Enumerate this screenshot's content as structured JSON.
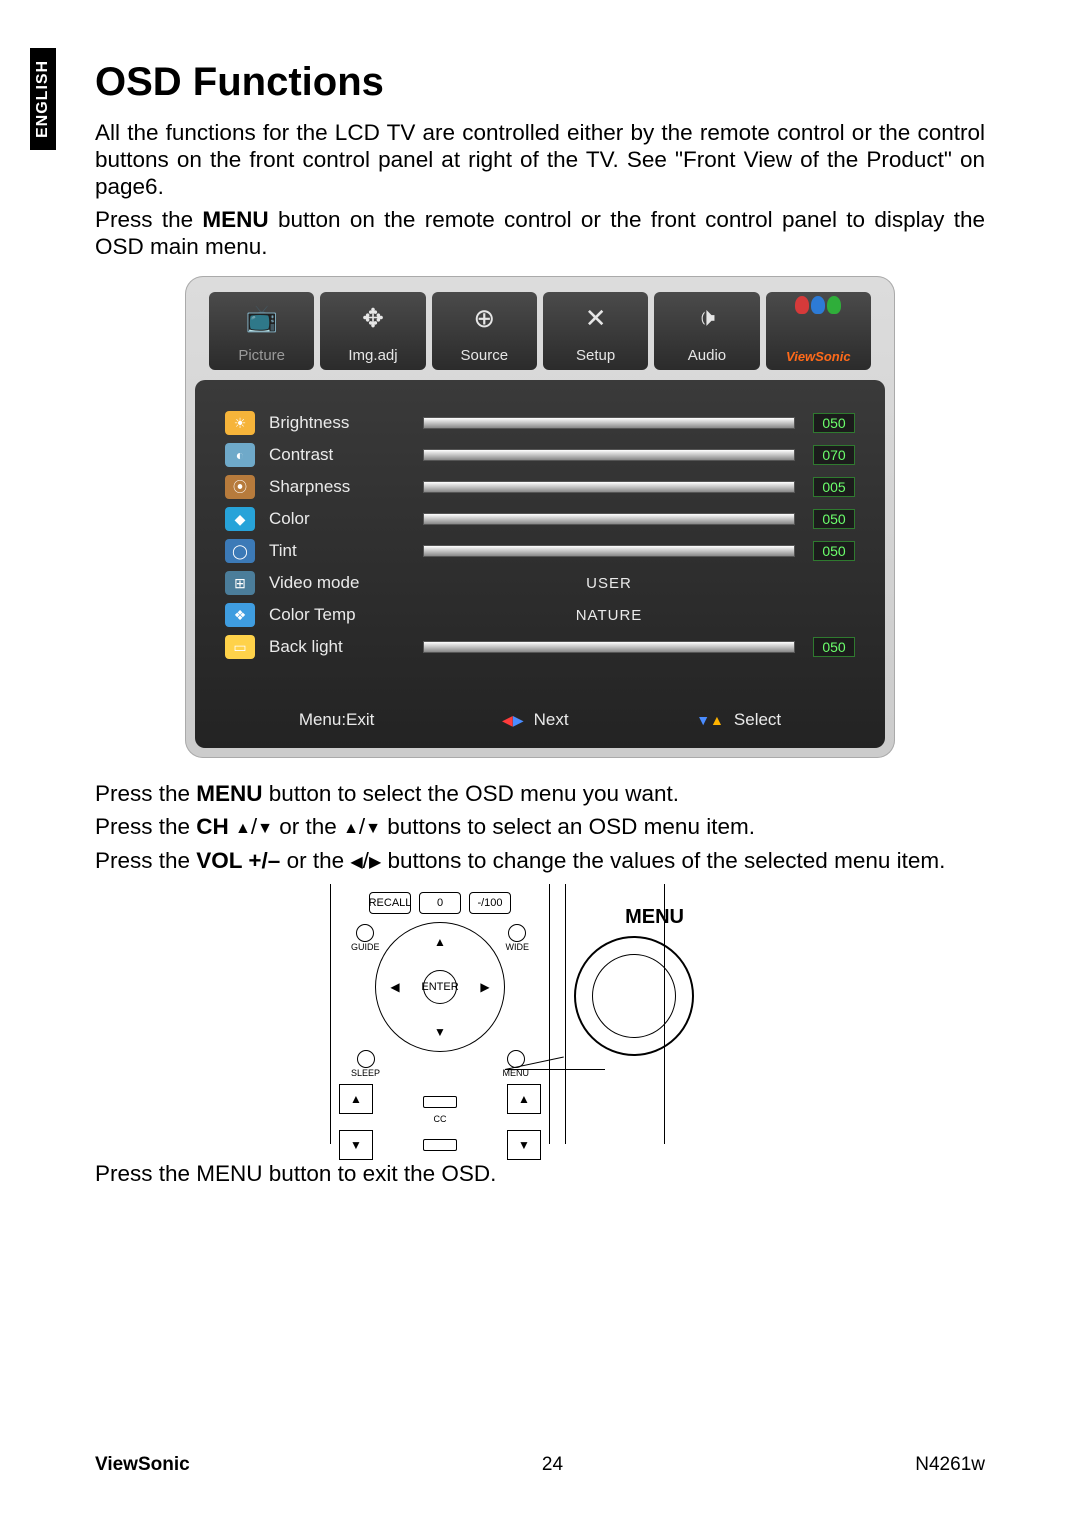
{
  "language_tab": "ENGLISH",
  "heading": "OSD Functions",
  "intro1": "All the functions for the LCD TV are controlled either by the remote control or the control buttons on the front control panel at right of the TV. See \"Front View of the Product\" on page6.",
  "intro2_a": "Press the ",
  "intro2_b": "MENU",
  "intro2_c": " button on the remote control or the front control panel to display the OSD main menu.",
  "osd": {
    "tabs": [
      {
        "label": "Picture",
        "icon": "📺"
      },
      {
        "label": "Img.adj",
        "icon": "✥"
      },
      {
        "label": "Source",
        "icon": "⊕"
      },
      {
        "label": "Setup",
        "icon": "✕"
      },
      {
        "label": "Audio",
        "icon": "🕩"
      },
      {
        "label": "ViewSonic",
        "icon": "birds",
        "brand": true
      }
    ],
    "rows": [
      {
        "label": "Brightness",
        "value": "050",
        "barFill": 50,
        "iconColor": "#f6b43a"
      },
      {
        "label": "Contrast",
        "value": "070",
        "barFill": 70,
        "iconColor": "#6fa9c9"
      },
      {
        "label": "Sharpness",
        "value": "005",
        "barFill": 5,
        "iconColor": "#b77b3c"
      },
      {
        "label": "Color",
        "value": "050",
        "barFill": 50,
        "iconColor": "#27a3d9"
      },
      {
        "label": "Tint",
        "value": "050",
        "barFill": 50,
        "iconColor": "#3c7ab7"
      },
      {
        "label": "Video mode",
        "centered": "USER"
      },
      {
        "label": "Color Temp",
        "centered": "NATURE"
      },
      {
        "label": "Back light",
        "value": "050",
        "barFill": 50,
        "iconColor": "#ffd24a"
      }
    ],
    "navExit": "Menu:Exit",
    "navNext": "Next",
    "navSelect": "Select"
  },
  "instr1_a": "Press the ",
  "instr1_b": "MENU",
  "instr1_c": " button to select the OSD menu you want.",
  "instr2_a": "Press the ",
  "instr2_b": "CH ",
  "instr2_c": "  or the  ",
  "instr2_d": "  buttons to select an OSD menu item.",
  "instr3_a": "Press the ",
  "instr3_b": "VOL +/–",
  "instr3_c": " or the  ",
  "instr3_d": "  buttons to change the values of the selected menu item.",
  "remote": {
    "recall": "RECALL",
    "zero": "0",
    "dash100": "-/100",
    "guide": "GUIDE",
    "wide": "WIDE",
    "enter": "ENTER",
    "sleep": "SLEEP",
    "menu": "MENU",
    "cc": "CC",
    "bigMenu": "MENU"
  },
  "instr4": "Press the MENU button to exit the OSD.",
  "footer": {
    "brand": "ViewSonic",
    "page": "24",
    "model": "N4261w"
  }
}
